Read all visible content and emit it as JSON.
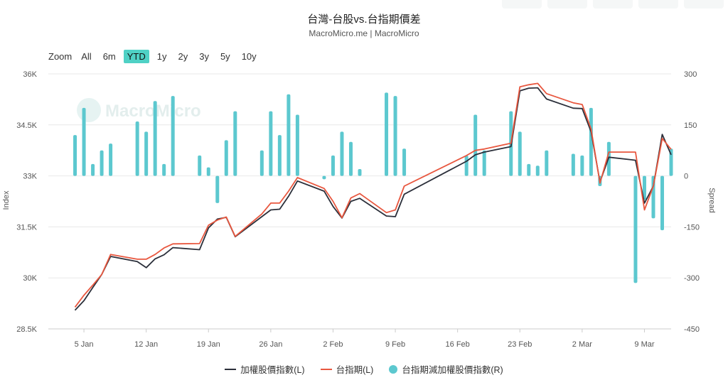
{
  "header": {
    "title": "台灣-台股vs.台指期價差",
    "subtitle": "MacroMicro.me | MacroMicro"
  },
  "range_selector": {
    "zoom_label": "Zoom",
    "buttons": [
      "All",
      "6m",
      "YTD",
      "1y",
      "2y",
      "3y",
      "5y",
      "10y"
    ],
    "active": "YTD"
  },
  "watermark": "MacroMicro",
  "colors": {
    "index_line": "#2b2f3a",
    "futures_line": "#e8573f",
    "spread_bar": "#5cc8cf",
    "active_button": "#4fd1c5"
  },
  "chart_data": {
    "type": "line",
    "title": "台灣-台股vs.台指期價差",
    "subtitle": "MacroMicro.me | MacroMicro",
    "xlabel": "",
    "ylabel": "Index",
    "y2label": "Spread",
    "x_range": [
      "2021-01-01",
      "2021-03-12"
    ],
    "x_ticks": [
      "5 Jan",
      "12 Jan",
      "19 Jan",
      "26 Jan",
      "2 Feb",
      "9 Feb",
      "16 Feb",
      "23 Feb",
      "2 Mar",
      "9 Mar"
    ],
    "x_tick_dates": [
      "2021-01-05",
      "2021-01-12",
      "2021-01-19",
      "2021-01-26",
      "2021-02-02",
      "2021-02-09",
      "2021-02-16",
      "2021-02-23",
      "2021-03-02",
      "2021-03-09"
    ],
    "ylim": [
      28500,
      36000
    ],
    "y_ticks": [
      "28.5K",
      "30K",
      "31.5K",
      "33K",
      "34.5K",
      "36K"
    ],
    "y_tick_values": [
      28500,
      30000,
      31500,
      33000,
      34500,
      36000
    ],
    "y2lim": [
      -450,
      300
    ],
    "y2_ticks": [
      "-450",
      "-300",
      "-150",
      "0",
      "150",
      "300"
    ],
    "y2_tick_values": [
      -450,
      -300,
      -150,
      0,
      150,
      300
    ],
    "grid": "horizontal",
    "legend_position": "bottom-center",
    "series": [
      {
        "name": "加權股價指數(L)",
        "axis": "left",
        "type": "line",
        "x": [
          "2021-01-04",
          "2021-01-05",
          "2021-01-06",
          "2021-01-07",
          "2021-01-08",
          "2021-01-11",
          "2021-01-12",
          "2021-01-13",
          "2021-01-14",
          "2021-01-15",
          "2021-01-18",
          "2021-01-19",
          "2021-01-20",
          "2021-01-21",
          "2021-01-22",
          "2021-01-25",
          "2021-01-26",
          "2021-01-27",
          "2021-01-28",
          "2021-01-29",
          "2021-02-01",
          "2021-02-02",
          "2021-02-03",
          "2021-02-04",
          "2021-02-05",
          "2021-02-08",
          "2021-02-09",
          "2021-02-10",
          "2021-02-17",
          "2021-02-18",
          "2021-02-19",
          "2021-02-22",
          "2021-02-23",
          "2021-02-24",
          "2021-02-25",
          "2021-02-26",
          "2021-03-01",
          "2021-03-02",
          "2021-03-03",
          "2021-03-04",
          "2021-03-05",
          "2021-03-08",
          "2021-03-09",
          "2021-03-10",
          "2021-03-11",
          "2021-03-12"
        ],
        "values": [
          29050,
          29330,
          29720,
          30100,
          30630,
          30480,
          30300,
          30560,
          30680,
          30890,
          30830,
          31470,
          31730,
          31780,
          31210,
          31800,
          32000,
          32020,
          32400,
          32850,
          32550,
          32100,
          31760,
          32250,
          32340,
          31820,
          31800,
          32460,
          33430,
          33620,
          33700,
          33860,
          35500,
          35580,
          35590,
          35260,
          34990,
          34980,
          34300,
          32820,
          33550,
          33460,
          32200,
          32700,
          34220,
          33620
        ]
      },
      {
        "name": "台指期(L)",
        "axis": "left",
        "type": "line",
        "x": [
          "2021-01-04",
          "2021-01-05",
          "2021-01-06",
          "2021-01-07",
          "2021-01-08",
          "2021-01-11",
          "2021-01-12",
          "2021-01-13",
          "2021-01-14",
          "2021-01-15",
          "2021-01-18",
          "2021-01-19",
          "2021-01-20",
          "2021-01-21",
          "2021-01-22",
          "2021-01-25",
          "2021-01-26",
          "2021-01-27",
          "2021-01-28",
          "2021-01-29",
          "2021-02-01",
          "2021-02-02",
          "2021-02-03",
          "2021-02-04",
          "2021-02-05",
          "2021-02-08",
          "2021-02-09",
          "2021-02-10",
          "2021-02-17",
          "2021-02-18",
          "2021-02-19",
          "2021-02-22",
          "2021-02-23",
          "2021-02-24",
          "2021-02-25",
          "2021-02-26",
          "2021-03-01",
          "2021-03-02",
          "2021-03-03",
          "2021-03-04",
          "2021-03-05",
          "2021-03-08",
          "2021-03-09",
          "2021-03-10",
          "2021-03-11",
          "2021-03-12"
        ],
        "values": [
          29140,
          29490,
          29790,
          30100,
          30690,
          30550,
          30550,
          30690,
          30880,
          31000,
          31010,
          31550,
          31700,
          31790,
          31220,
          31880,
          32200,
          32200,
          32550,
          32950,
          32630,
          32250,
          31770,
          32350,
          32480,
          31920,
          32000,
          32700,
          33600,
          33750,
          33790,
          33960,
          35620,
          35680,
          35720,
          35420,
          35150,
          35100,
          34380,
          32790,
          33700,
          33700,
          32000,
          32700,
          34100,
          33780
        ]
      },
      {
        "name": "台指期減加權股價指數(R)",
        "axis": "right",
        "type": "bar",
        "x": [
          "2021-01-04",
          "2021-01-05",
          "2021-01-06",
          "2021-01-07",
          "2021-01-08",
          "2021-01-11",
          "2021-01-12",
          "2021-01-13",
          "2021-01-14",
          "2021-01-15",
          "2021-01-18",
          "2021-01-19",
          "2021-01-20",
          "2021-01-21",
          "2021-01-22",
          "2021-01-25",
          "2021-01-26",
          "2021-01-27",
          "2021-01-28",
          "2021-01-29",
          "2021-02-01",
          "2021-02-02",
          "2021-02-03",
          "2021-02-04",
          "2021-02-05",
          "2021-02-08",
          "2021-02-09",
          "2021-02-10",
          "2021-02-17",
          "2021-02-18",
          "2021-02-19",
          "2021-02-22",
          "2021-02-23",
          "2021-02-24",
          "2021-02-25",
          "2021-02-26",
          "2021-03-01",
          "2021-03-02",
          "2021-03-03",
          "2021-03-04",
          "2021-03-05",
          "2021-03-08",
          "2021-03-09",
          "2021-03-10",
          "2021-03-11",
          "2021-03-12"
        ],
        "values": [
          120,
          200,
          35,
          75,
          95,
          160,
          130,
          220,
          35,
          235,
          60,
          25,
          -80,
          105,
          190,
          75,
          190,
          120,
          240,
          180,
          -10,
          60,
          130,
          100,
          20,
          245,
          235,
          80,
          60,
          180,
          75,
          190,
          130,
          35,
          30,
          75,
          65,
          60,
          200,
          -30,
          100,
          -315,
          -70,
          -125,
          -160,
          80
        ]
      }
    ]
  },
  "legend": [
    {
      "label": "加權股價指數(L)",
      "kind": "line",
      "color": "#2b2f3a"
    },
    {
      "label": "台指期(L)",
      "kind": "line",
      "color": "#e8573f"
    },
    {
      "label": "台指期減加權股價指數(R)",
      "kind": "dot",
      "color": "#5cc8cf"
    }
  ]
}
